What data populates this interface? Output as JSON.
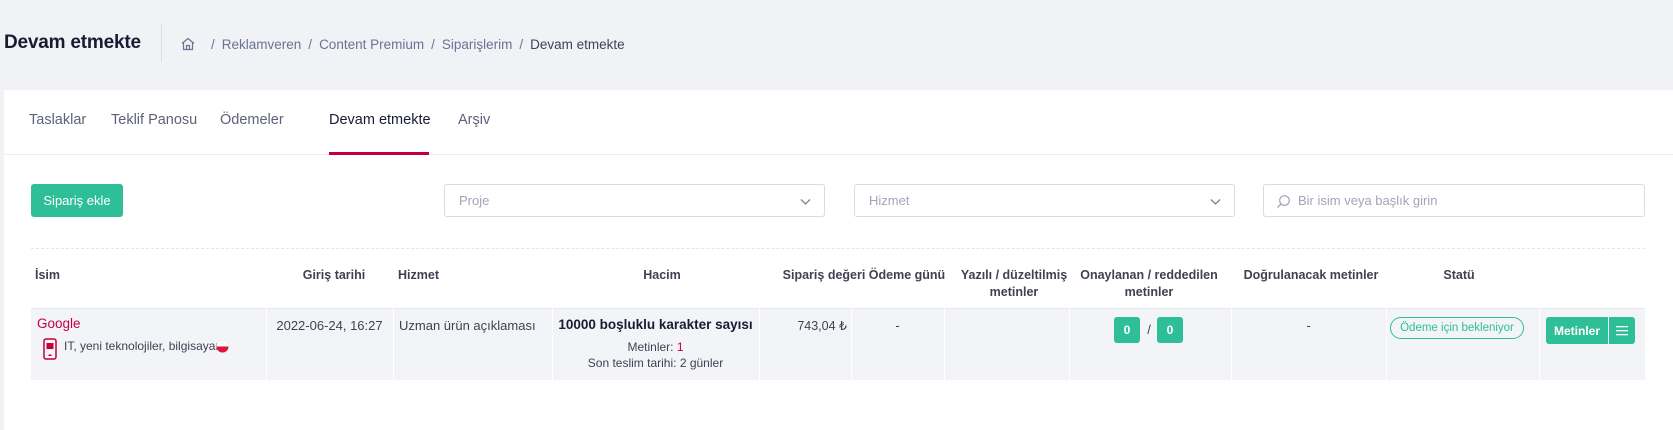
{
  "header": {
    "title": "Devam etmekte",
    "breadcrumb": [
      "Reklamveren",
      "Content Premium",
      "Siparişlerim",
      "Devam etmekte"
    ]
  },
  "tabs": [
    {
      "label": "Taslaklar"
    },
    {
      "label": "Teklif Panosu"
    },
    {
      "label": "Ödemeler"
    },
    {
      "label": "Devam etmekte",
      "active": true
    },
    {
      "label": "Arşiv"
    }
  ],
  "toolbar": {
    "add_button": "Sipariş ekle",
    "project_placeholder": "Proje",
    "service_placeholder": "Hizmet",
    "search_placeholder": "Bir isim veya başlık girin"
  },
  "table": {
    "columns": {
      "name": "İsim",
      "entry_date": "Giriş tarihi",
      "service": "Hizmet",
      "volume": "Hacim",
      "order_value": "Sipariş değeri",
      "payment_day": "Ödeme günü",
      "written_l1": "Yazılı / düzeltilmiş",
      "written_l2": "metinler",
      "approved_l1": "Onaylanan / reddedilen",
      "approved_l2": "metinler",
      "to_verify": "Doğrulanacak metinler",
      "status": "Statü"
    },
    "rows": [
      {
        "name": "Google",
        "category": "IT, yeni teknolojiler, bilgisayar",
        "entry_date": "2022-06-24, 16:27",
        "service": "Uzman ürün açıklaması",
        "volume_title": "10000 boşluklu karakter sayısı",
        "texts_label": "Metinler:",
        "texts_count": "1",
        "deadline_label": "Son teslim tarihi:",
        "deadline_value": "2 günler",
        "order_value": "743,04 ₺",
        "payment_day": "-",
        "approved": "0",
        "approved_sep": "/",
        "rejected": "0",
        "to_verify": "-",
        "status": "Ödeme için bekleniyor",
        "texts_button": "Metinler"
      }
    ]
  },
  "colors": {
    "accent_green": "#2fbf98",
    "accent_red": "#c2003c"
  }
}
